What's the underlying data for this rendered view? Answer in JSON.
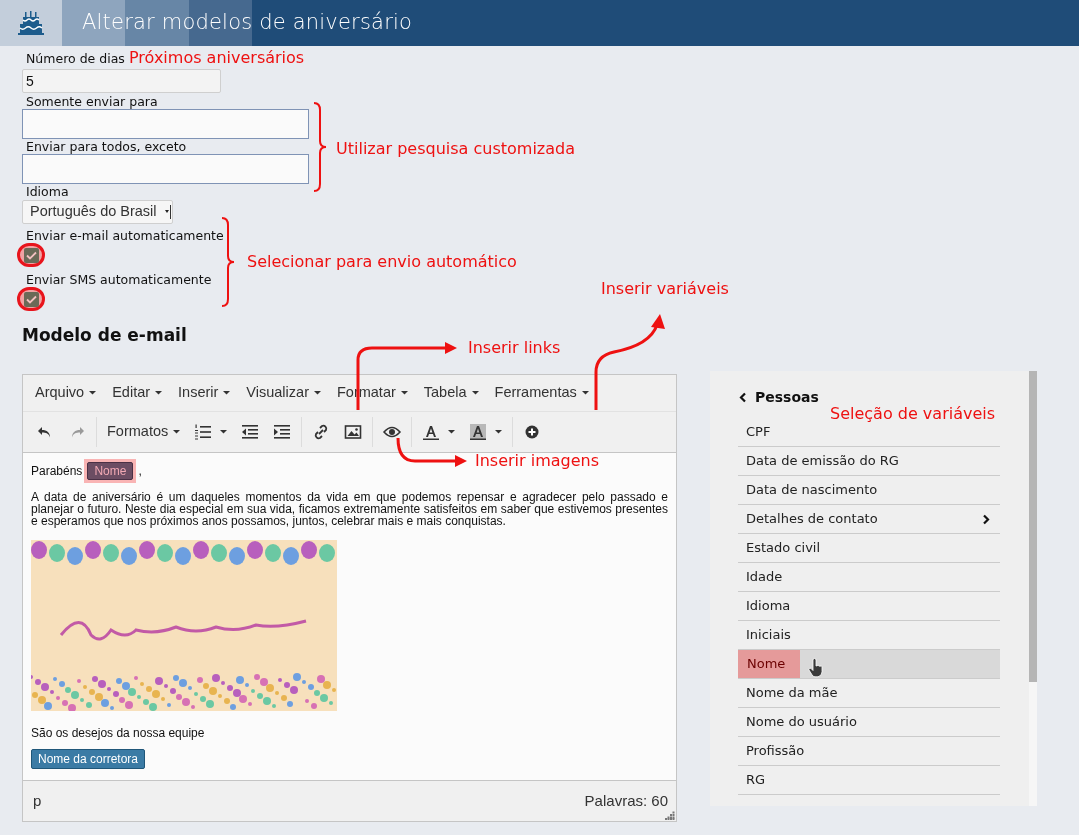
{
  "window": {
    "title": "Alterar modelos de aniversário"
  },
  "form": {
    "fields": [
      {
        "kind": "number",
        "label": "Número de dias",
        "value": "5"
      },
      {
        "kind": "search",
        "label": "Somente enviar para"
      },
      {
        "kind": "search",
        "label": "Enviar para todos, exceto"
      },
      {
        "kind": "select",
        "label": "Idioma",
        "value": "Português do Brasil"
      },
      {
        "kind": "checkbox",
        "label": "Enviar e-mail automaticamente",
        "checked": true,
        "highlighted": true
      },
      {
        "kind": "checkbox",
        "label": "Enviar SMS automaticamente",
        "checked": true,
        "highlighted": true
      }
    ]
  },
  "section_title": "Modelo de e-mail",
  "editor": {
    "menu": [
      "Arquivo",
      "Editar",
      "Inserir",
      "Visualizar",
      "Formatar",
      "Tabela",
      "Ferramentas"
    ],
    "toolbar": {
      "formats": "Formatos"
    },
    "content": {
      "greeting": "Parabéns",
      "name_tag": "Nome",
      "name_tag_highlighted": true,
      "comma": ",",
      "paragraph": "A data de aniversário é um daqueles momentos da vida em que podemos repensar e agradecer pelo passado e planejar o futuro. Neste dia especial em sua vida, ficamos extremamente satisfeitos em saber que estivemos presentes e esperamos que nos próximos anos possamos, juntos, celebrar mais e mais conquistas.",
      "closing": "São os desejos da nossa equipe",
      "signature_tag": "Nome da corretora"
    },
    "status": {
      "path": "p",
      "word_count": "Palavras: 60"
    }
  },
  "variables_panel": {
    "title": "Pessoas",
    "items": [
      {
        "label": "CPF",
        "has_children": false,
        "selected": false
      },
      {
        "label": "Data de emissão do RG",
        "has_children": false,
        "selected": false
      },
      {
        "label": "Data de nascimento",
        "has_children": false,
        "selected": false
      },
      {
        "label": "Detalhes de contato",
        "has_children": true,
        "selected": false
      },
      {
        "label": "Estado civil",
        "has_children": false,
        "selected": false
      },
      {
        "label": "Idade",
        "has_children": false,
        "selected": false
      },
      {
        "label": "Idioma",
        "has_children": false,
        "selected": false
      },
      {
        "label": "Iniciais",
        "has_children": false,
        "selected": false
      },
      {
        "label": "Nome",
        "has_children": false,
        "selected": true
      },
      {
        "label": "Nome da mãe",
        "has_children": false,
        "selected": false
      },
      {
        "label": "Nome do usuário",
        "has_children": false,
        "selected": false
      },
      {
        "label": "Profissão",
        "has_children": false,
        "selected": false
      },
      {
        "label": "RG",
        "has_children": false,
        "selected": false
      }
    ]
  },
  "annotations": [
    {
      "kind": "label",
      "text": "Próximos aniversários"
    },
    {
      "kind": "brace",
      "text": "Utilizar pesquisa customizada"
    },
    {
      "kind": "brace",
      "text": "Selecionar para envio automático"
    },
    {
      "kind": "arrow",
      "text": "Inserir variáveis"
    },
    {
      "kind": "arrow",
      "text": "Inserir links"
    },
    {
      "kind": "arrow",
      "text": "Inserir imagens"
    },
    {
      "kind": "label",
      "text": "Seleção de variáveis"
    }
  ]
}
